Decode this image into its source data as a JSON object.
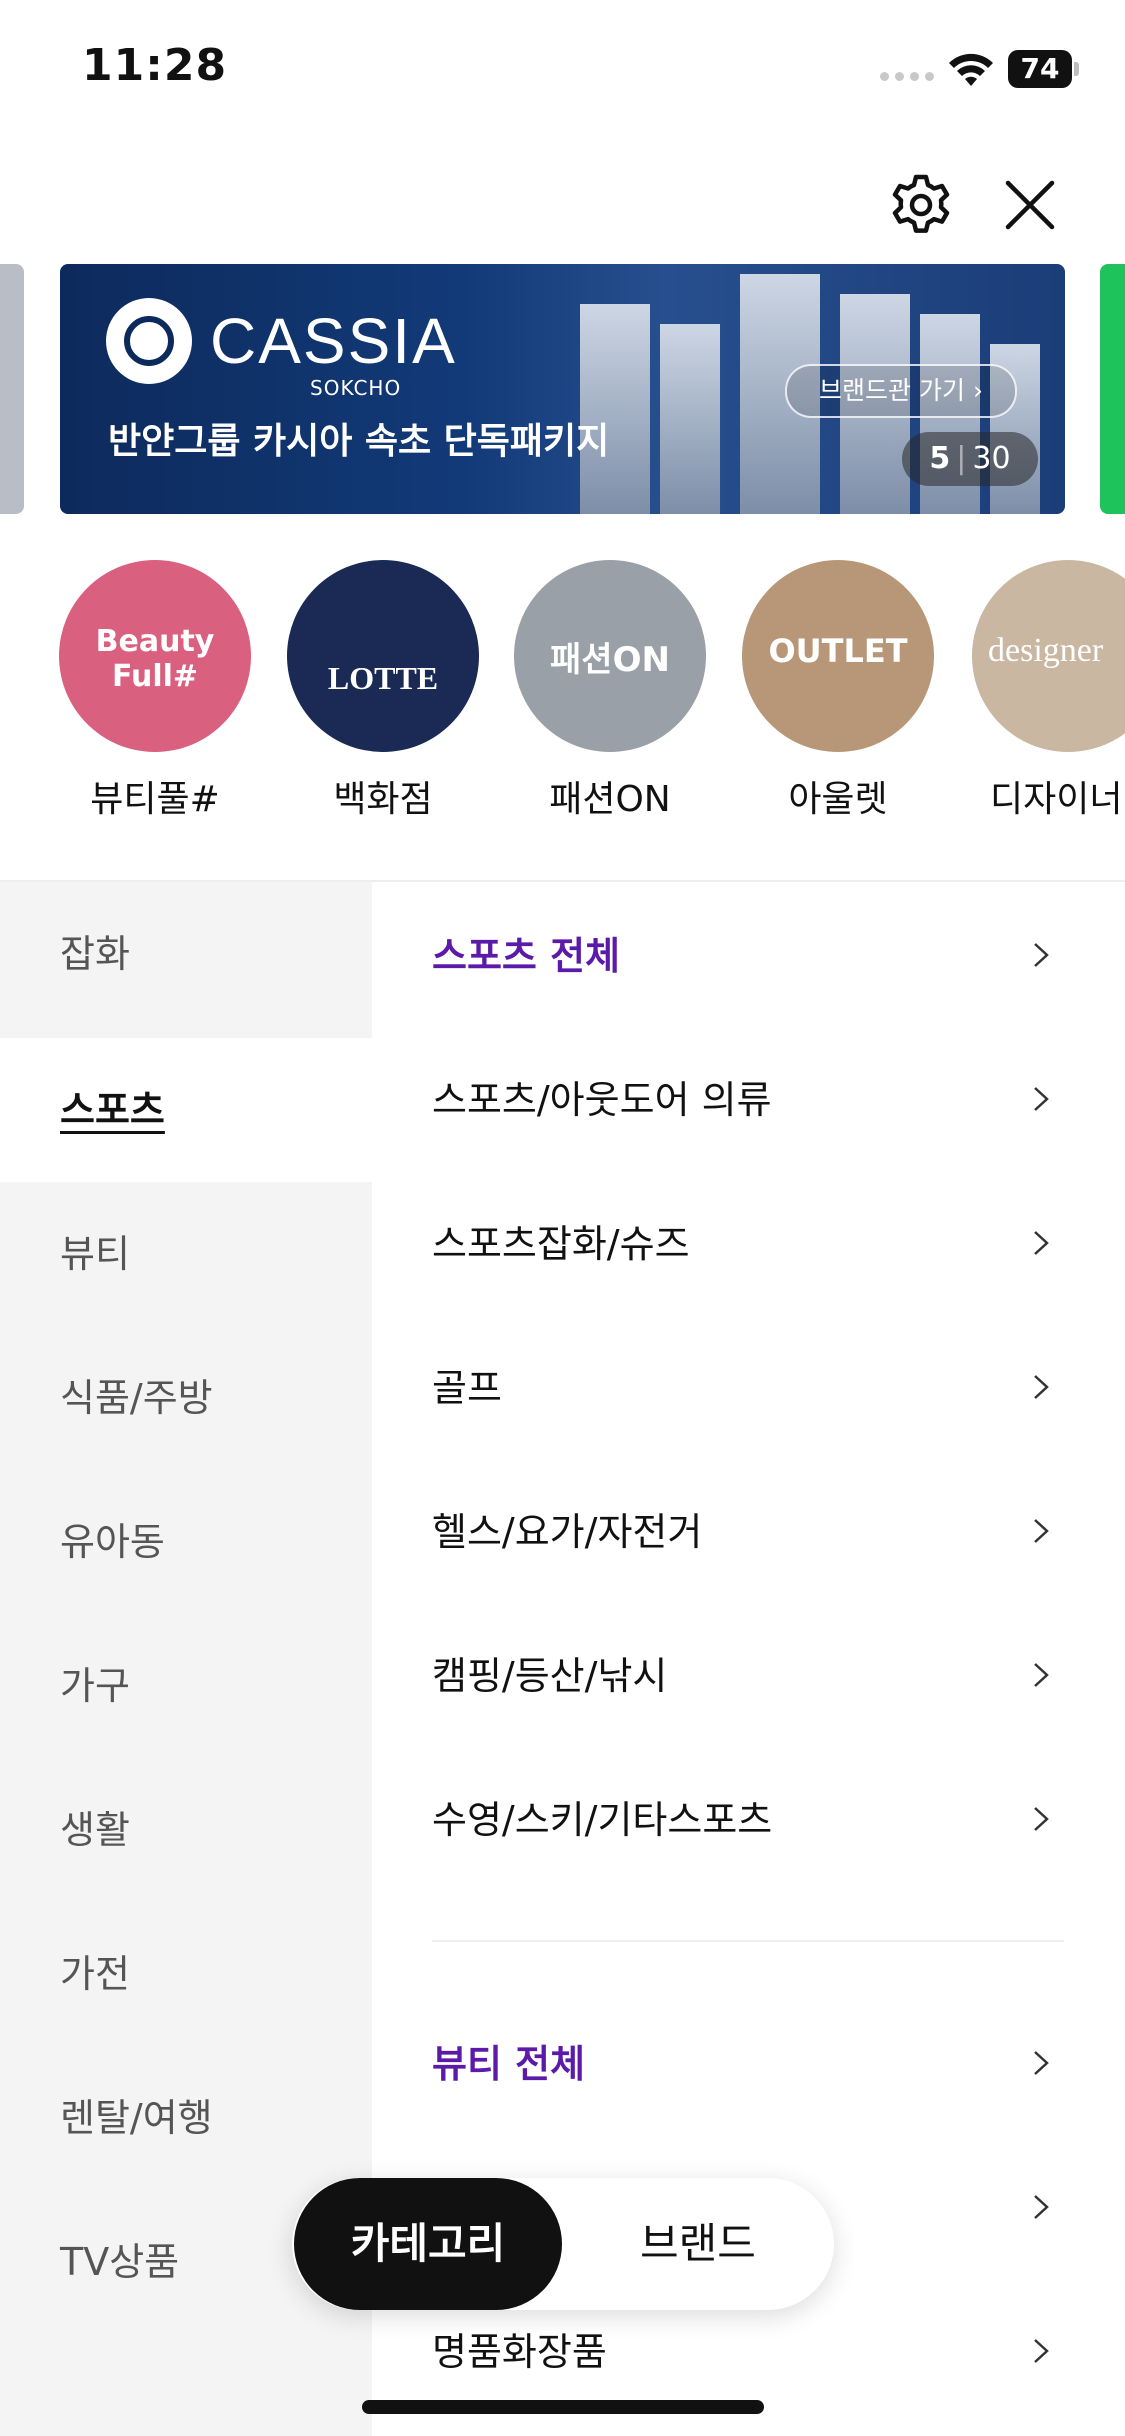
{
  "status_bar": {
    "time": "11:28",
    "battery": "74"
  },
  "header": {
    "settings_icon": "gear-icon",
    "close_icon": "close-icon"
  },
  "banner": {
    "brand": "CASSIA",
    "brand_sub": "SOKCHO",
    "headline": "반얀그룹 카시아 속초 단독패키지",
    "button_label": "브랜드관 가기 ›",
    "current": "5",
    "total": "30"
  },
  "shortcuts": [
    {
      "label": "뷰티풀#",
      "overlay": "Beauty Full#",
      "color": "#d9607e"
    },
    {
      "label": "백화점",
      "overlay": "LOTTE",
      "color": "#1a2a55"
    },
    {
      "label": "패션ON",
      "overlay": "패션ON",
      "color": "#9aa0a8"
    },
    {
      "label": "아울렛",
      "overlay": "OUTLET",
      "color": "#b89778"
    },
    {
      "label": "디자이너",
      "overlay": "designer",
      "color": "#c9b7a1"
    }
  ],
  "categories": [
    {
      "label": "잡화"
    },
    {
      "label": "스포츠"
    },
    {
      "label": "뷰티"
    },
    {
      "label": "식품/주방"
    },
    {
      "label": "유아동"
    },
    {
      "label": "가구"
    },
    {
      "label": "생활"
    },
    {
      "label": "가전"
    },
    {
      "label": "렌탈/여행"
    },
    {
      "label": "TV상품"
    }
  ],
  "subcategories": {
    "sports_all": "스포츠 전체",
    "sports": [
      "스포츠/아웃도어 의류",
      "스포츠잡화/슈즈",
      "골프",
      "헬스/요가/자전거",
      "캠핑/등산/낚시",
      "수영/스키/기타스포츠"
    ],
    "beauty_all": "뷰티 전체",
    "beauty": [
      "",
      "명품화장품"
    ]
  },
  "bottom_toggle": {
    "category": "카테고리",
    "brand": "브랜드"
  },
  "colors": {
    "accent": "#5b1aa8",
    "active_bg": "#ffffff",
    "sidebar_bg": "#f4f4f4"
  }
}
